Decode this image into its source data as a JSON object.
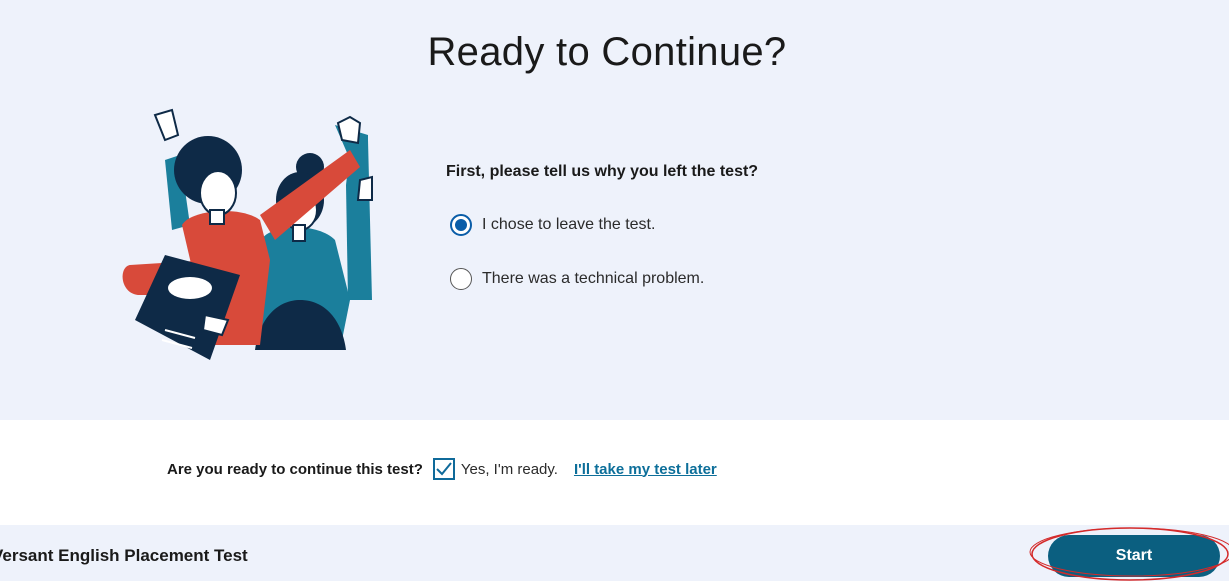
{
  "header": {
    "title": "Ready to Continue?"
  },
  "form": {
    "question": "First, please tell us why you left the test?",
    "options": [
      {
        "label": "I chose to leave the test.",
        "selected": true
      },
      {
        "label": "There was a technical problem.",
        "selected": false
      }
    ]
  },
  "confirm": {
    "question": "Are you ready to continue this test?",
    "checkbox_label": "Yes, I'm ready.",
    "checked": true,
    "later_link": "I'll take my test later"
  },
  "footer": {
    "test_name": "Versant English Placement Test",
    "start_label": "Start"
  },
  "colors": {
    "panel_bg": "#eef2fb",
    "accent_blue": "#0a5da8",
    "button_bg": "#0b5f80",
    "link": "#0d6f9a",
    "annotation_red": "#d42a2a"
  },
  "icons": [
    "radio-selected-icon",
    "radio-unselected-icon",
    "checkmark-icon",
    "people-illustration"
  ]
}
